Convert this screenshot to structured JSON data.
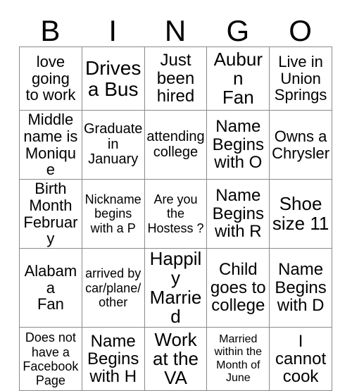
{
  "card": {
    "header_letters": [
      "B",
      "I",
      "N",
      "G",
      "O"
    ],
    "grid": {
      "columns": 5,
      "rows": 5,
      "border_color": "#8a8a8a",
      "text_color": "#000000",
      "background_color": "#ffffff"
    },
    "cells": [
      [
        {
          "text": "love\ngoing\nto work",
          "size": "fs-22"
        },
        {
          "text": "Drives\na Bus",
          "size": "fs-28"
        },
        {
          "text": "Just\nbeen\nhired",
          "size": "fs-24"
        },
        {
          "text": "Auburn\nFan",
          "size": "fs-26"
        },
        {
          "text": "Live in\nUnion\nSprings",
          "size": "fs-22"
        }
      ],
      [
        {
          "text": "Middle\nname is\nMonique",
          "size": "fs-22"
        },
        {
          "text": "Graduate\nin\nJanuary",
          "size": "fs-20"
        },
        {
          "text": "attending\ncollege",
          "size": "fs-20"
        },
        {
          "text": "Name\nBegins\nwith O",
          "size": "fs-24"
        },
        {
          "text": "Owns a\nChrysler",
          "size": "fs-22"
        }
      ],
      [
        {
          "text": "Birth\nMonth\nFebruary",
          "size": "fs-22"
        },
        {
          "text": "Nickname\nbegins\nwith a P",
          "size": "fs-18"
        },
        {
          "text": "Are you\nthe\nHostess ?",
          "size": "fs-18"
        },
        {
          "text": "Name\nBegins\nwith R",
          "size": "fs-24"
        },
        {
          "text": "Shoe\nsize 11",
          "size": "fs-26"
        }
      ],
      [
        {
          "text": "Alabama\nFan",
          "size": "fs-22"
        },
        {
          "text": "arrived by\ncar/plane/\nother",
          "size": "fs-18"
        },
        {
          "text": "Happily\nMarried",
          "size": "fs-26"
        },
        {
          "text": "Child\ngoes to\ncollege",
          "size": "fs-24"
        },
        {
          "text": "Name\nBegins\nwith D",
          "size": "fs-24"
        }
      ],
      [
        {
          "text": "Does not\nhave a\nFacebook\nPage",
          "size": "fs-18"
        },
        {
          "text": "Name\nBegins\nwith H",
          "size": "fs-24"
        },
        {
          "text": "Work\nat the\nVA",
          "size": "fs-26"
        },
        {
          "text": "Married\nwithin the\nMonth of\nJune",
          "size": "fs-16"
        },
        {
          "text": "I\ncannot\ncook",
          "size": "fs-24"
        }
      ]
    ]
  }
}
